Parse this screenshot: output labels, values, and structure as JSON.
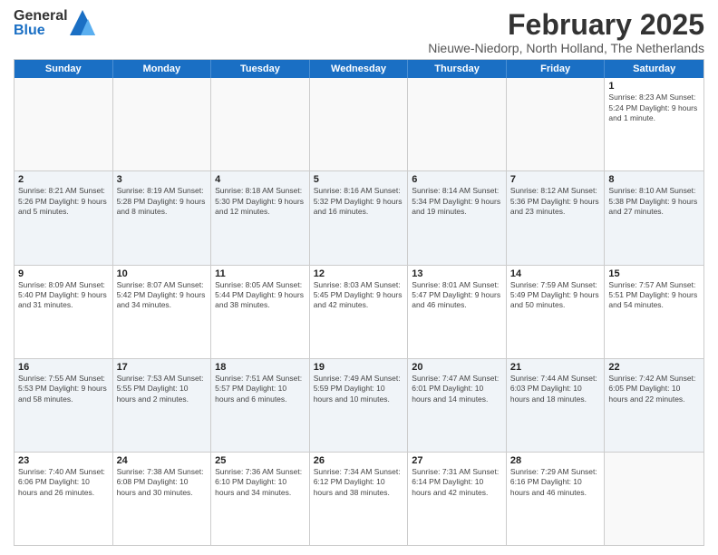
{
  "logo": {
    "line1": "General",
    "line2": "Blue"
  },
  "title": "February 2025",
  "location": "Nieuwe-Niedorp, North Holland, The Netherlands",
  "weekdays": [
    "Sunday",
    "Monday",
    "Tuesday",
    "Wednesday",
    "Thursday",
    "Friday",
    "Saturday"
  ],
  "rows": [
    [
      {
        "day": "",
        "info": ""
      },
      {
        "day": "",
        "info": ""
      },
      {
        "day": "",
        "info": ""
      },
      {
        "day": "",
        "info": ""
      },
      {
        "day": "",
        "info": ""
      },
      {
        "day": "",
        "info": ""
      },
      {
        "day": "1",
        "info": "Sunrise: 8:23 AM\nSunset: 5:24 PM\nDaylight: 9 hours and 1 minute."
      }
    ],
    [
      {
        "day": "2",
        "info": "Sunrise: 8:21 AM\nSunset: 5:26 PM\nDaylight: 9 hours and 5 minutes."
      },
      {
        "day": "3",
        "info": "Sunrise: 8:19 AM\nSunset: 5:28 PM\nDaylight: 9 hours and 8 minutes."
      },
      {
        "day": "4",
        "info": "Sunrise: 8:18 AM\nSunset: 5:30 PM\nDaylight: 9 hours and 12 minutes."
      },
      {
        "day": "5",
        "info": "Sunrise: 8:16 AM\nSunset: 5:32 PM\nDaylight: 9 hours and 16 minutes."
      },
      {
        "day": "6",
        "info": "Sunrise: 8:14 AM\nSunset: 5:34 PM\nDaylight: 9 hours and 19 minutes."
      },
      {
        "day": "7",
        "info": "Sunrise: 8:12 AM\nSunset: 5:36 PM\nDaylight: 9 hours and 23 minutes."
      },
      {
        "day": "8",
        "info": "Sunrise: 8:10 AM\nSunset: 5:38 PM\nDaylight: 9 hours and 27 minutes."
      }
    ],
    [
      {
        "day": "9",
        "info": "Sunrise: 8:09 AM\nSunset: 5:40 PM\nDaylight: 9 hours and 31 minutes."
      },
      {
        "day": "10",
        "info": "Sunrise: 8:07 AM\nSunset: 5:42 PM\nDaylight: 9 hours and 34 minutes."
      },
      {
        "day": "11",
        "info": "Sunrise: 8:05 AM\nSunset: 5:44 PM\nDaylight: 9 hours and 38 minutes."
      },
      {
        "day": "12",
        "info": "Sunrise: 8:03 AM\nSunset: 5:45 PM\nDaylight: 9 hours and 42 minutes."
      },
      {
        "day": "13",
        "info": "Sunrise: 8:01 AM\nSunset: 5:47 PM\nDaylight: 9 hours and 46 minutes."
      },
      {
        "day": "14",
        "info": "Sunrise: 7:59 AM\nSunset: 5:49 PM\nDaylight: 9 hours and 50 minutes."
      },
      {
        "day": "15",
        "info": "Sunrise: 7:57 AM\nSunset: 5:51 PM\nDaylight: 9 hours and 54 minutes."
      }
    ],
    [
      {
        "day": "16",
        "info": "Sunrise: 7:55 AM\nSunset: 5:53 PM\nDaylight: 9 hours and 58 minutes."
      },
      {
        "day": "17",
        "info": "Sunrise: 7:53 AM\nSunset: 5:55 PM\nDaylight: 10 hours and 2 minutes."
      },
      {
        "day": "18",
        "info": "Sunrise: 7:51 AM\nSunset: 5:57 PM\nDaylight: 10 hours and 6 minutes."
      },
      {
        "day": "19",
        "info": "Sunrise: 7:49 AM\nSunset: 5:59 PM\nDaylight: 10 hours and 10 minutes."
      },
      {
        "day": "20",
        "info": "Sunrise: 7:47 AM\nSunset: 6:01 PM\nDaylight: 10 hours and 14 minutes."
      },
      {
        "day": "21",
        "info": "Sunrise: 7:44 AM\nSunset: 6:03 PM\nDaylight: 10 hours and 18 minutes."
      },
      {
        "day": "22",
        "info": "Sunrise: 7:42 AM\nSunset: 6:05 PM\nDaylight: 10 hours and 22 minutes."
      }
    ],
    [
      {
        "day": "23",
        "info": "Sunrise: 7:40 AM\nSunset: 6:06 PM\nDaylight: 10 hours and 26 minutes."
      },
      {
        "day": "24",
        "info": "Sunrise: 7:38 AM\nSunset: 6:08 PM\nDaylight: 10 hours and 30 minutes."
      },
      {
        "day": "25",
        "info": "Sunrise: 7:36 AM\nSunset: 6:10 PM\nDaylight: 10 hours and 34 minutes."
      },
      {
        "day": "26",
        "info": "Sunrise: 7:34 AM\nSunset: 6:12 PM\nDaylight: 10 hours and 38 minutes."
      },
      {
        "day": "27",
        "info": "Sunrise: 7:31 AM\nSunset: 6:14 PM\nDaylight: 10 hours and 42 minutes."
      },
      {
        "day": "28",
        "info": "Sunrise: 7:29 AM\nSunset: 6:16 PM\nDaylight: 10 hours and 46 minutes."
      },
      {
        "day": "",
        "info": ""
      }
    ]
  ],
  "alt_rows": [
    1,
    3
  ]
}
